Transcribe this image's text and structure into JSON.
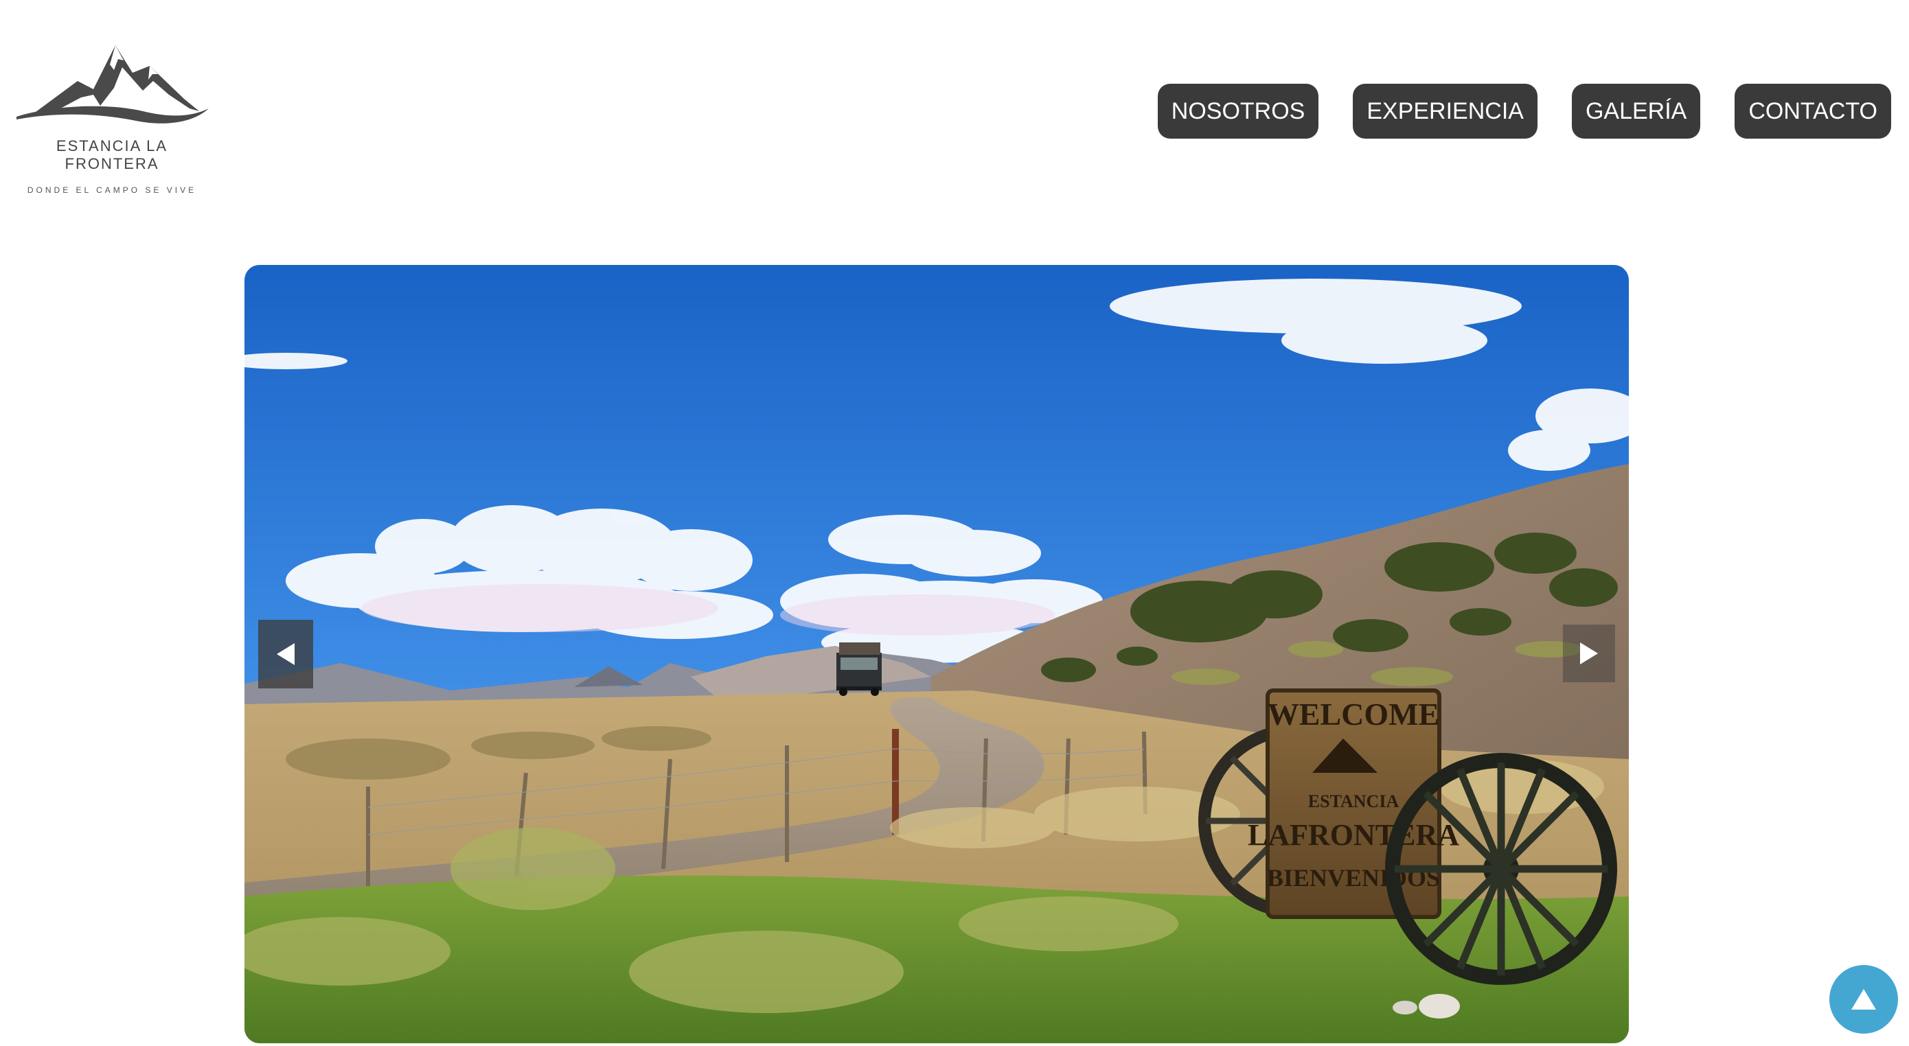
{
  "logo": {
    "name": "ESTANCIA LA FRONTERA",
    "tagline": "DONDE EL CAMPO SE VIVE"
  },
  "nav": {
    "items": [
      {
        "label": "NOSOTROS"
      },
      {
        "label": "EXPERIENCIA"
      },
      {
        "label": "GALERÍA"
      },
      {
        "label": "CONTACTO"
      }
    ]
  },
  "hero": {
    "sign_line1": "WELCOME",
    "sign_line2": "ESTANCIA",
    "sign_line3": "LAFRONTERA",
    "sign_line4": "BIENVENIDOS",
    "prev_icon": "triangle-left-icon",
    "next_icon": "triangle-right-icon"
  },
  "scroll_top": {
    "icon": "triangle-up-icon"
  },
  "colors": {
    "nav_bg": "#3a3a3a",
    "nav_text": "#ffffff",
    "scroll_top_bg": "#44a7d2",
    "logo_text": "#444444"
  }
}
